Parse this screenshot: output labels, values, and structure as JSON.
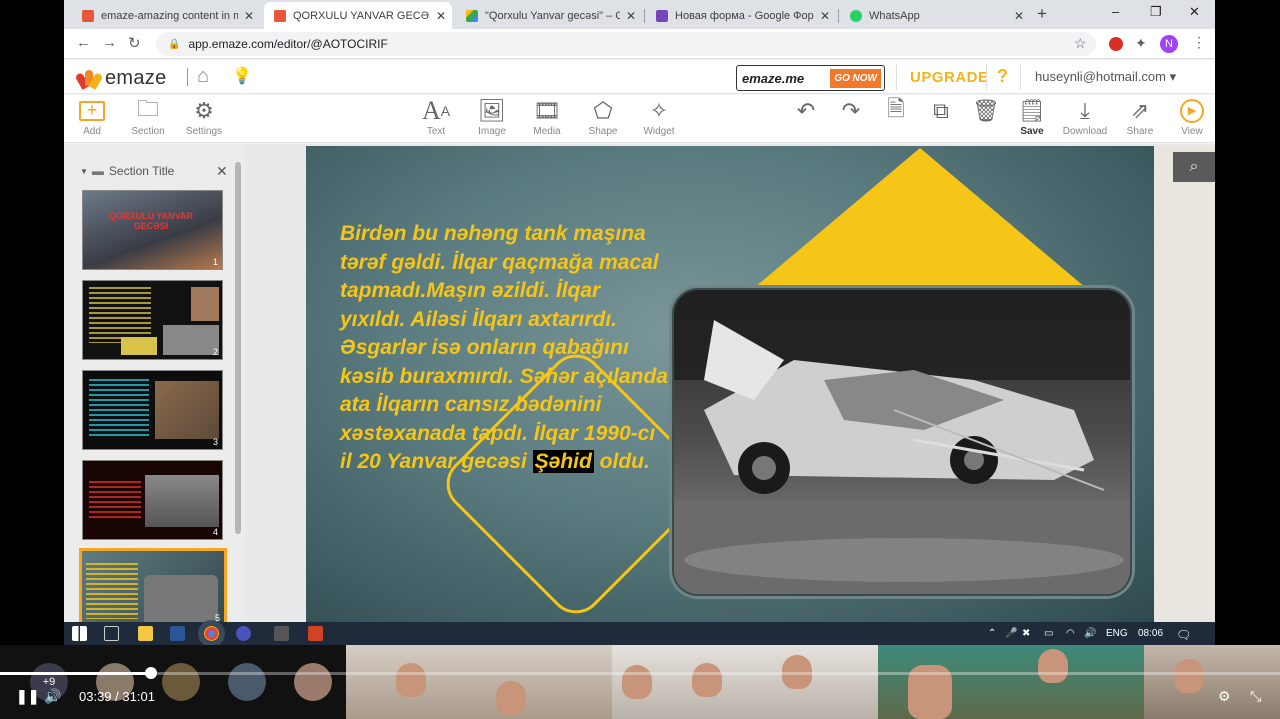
{
  "browser": {
    "tabs": [
      {
        "title": "emaze-amazing content in m",
        "favicon_color": "#e8563a"
      },
      {
        "title": "QORXULU YANVAR GECƏSİ by",
        "favicon_color": "#e8563a"
      },
      {
        "title": "\"Qorxulu Yanvar gecəsi\" – Goo",
        "favicon_color": "#4285f4"
      },
      {
        "title": "Новая форма - Google Форм",
        "favicon_color": "#7248b9"
      },
      {
        "title": "WhatsApp",
        "favicon_color": "#25d366"
      }
    ],
    "tab_close": "✕",
    "new_tab": "+",
    "url": "app.emaze.com/editor/@AOTOCIRIF",
    "profile_initial": "N",
    "win_min": "–",
    "win_max": "❐",
    "win_close": "✕"
  },
  "emaze": {
    "logo_text": "emaze",
    "emme_label": "emaze.me",
    "go_now": "GO NOW",
    "upgrade": "UPGRADE",
    "help": "?",
    "user": "huseynli@hotmail.com ▾",
    "toolbar": {
      "add": "Add",
      "section": "Section",
      "settings": "Settings",
      "text": "Text",
      "image": "Image",
      "media": "Media",
      "shape": "Shape",
      "widget": "Widget",
      "save": "Save",
      "download": "Download",
      "share": "Share",
      "view": "View"
    },
    "section_title": "Section Title",
    "thumbs": [
      {
        "num": "1",
        "title": "QORXULU YANVAR GECƏSİ"
      },
      {
        "num": "2"
      },
      {
        "num": "3"
      },
      {
        "num": "4"
      },
      {
        "num": "5"
      }
    ]
  },
  "slide": {
    "text_before": "Birdən bu nəhəng tank maşına tərəf gəldi. İlqar qaçmağa macal tapmadı.Maşın əzildi. İlqar yıxıldı. Ailəsi İlqarı axtarırdı. Əsgarlər isə onların qabağını kəsib buraxmırdı. Səhər açılanda ata İlqarın cansız bədənini xəstəxanada tapdı. İlqar 1990-cı il 20 Yanvar gecəsi ",
    "highlight": "Şəhid",
    "text_after": " oldu."
  },
  "taskbar": {
    "lang": "ENG",
    "clock": "08:06"
  },
  "player": {
    "current": "03:39",
    "separator": "/",
    "duration": "31:01",
    "participants_extra": "+9",
    "progress_fraction": 0.118
  }
}
